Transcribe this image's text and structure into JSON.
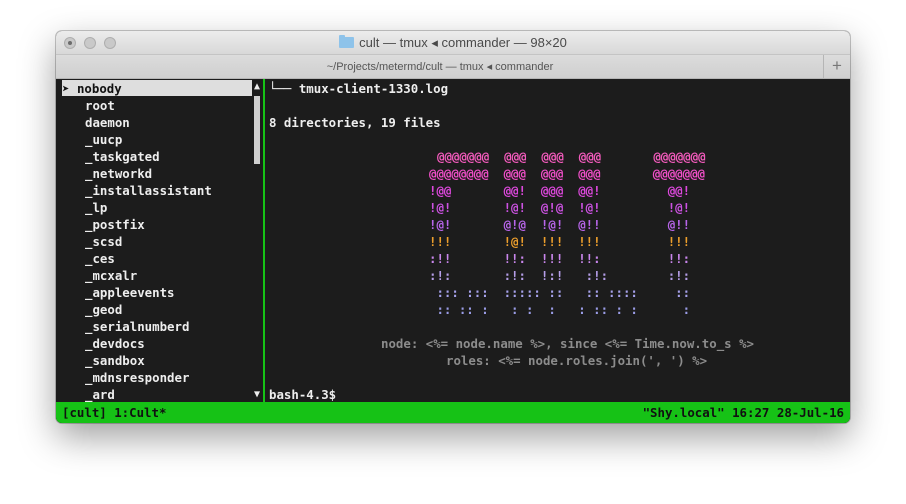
{
  "window": {
    "title": "cult — tmux ◂ commander — 98×20",
    "tab_title": "~/Projects/metermd/cult — tmux ◂ commander",
    "new_tab_label": "+"
  },
  "left_pane": {
    "selected_marker": "➤",
    "users": [
      "nobody",
      "root",
      "daemon",
      "_uucp",
      "_taskgated",
      "_networkd",
      "_installassistant",
      "_lp",
      "_postfix",
      "_scsd",
      "_ces",
      "_mcxalr",
      "_appleevents",
      "_geod",
      "_serialnumberd",
      "_devdocs",
      "_sandbox",
      "_mdnsresponder",
      "_ard"
    ],
    "scroll_up": "▲",
    "scroll_down": "▼"
  },
  "right_pane": {
    "tree_line": "└── tmux-client-1330.log",
    "summary": "8 directories, 19 files",
    "ascii_art": [
      "@@@@@@@  @@@  @@@  @@@       @@@@@@@",
      "@@@@@@@@  @@@  @@@  @@@       @@@@@@@",
      "!@@       @@!  @@@  @@!         @@!",
      "!@!       !@!  @!@  !@!         !@!",
      "!@!       @!@  !@!  @!!         @!!",
      "!!!       !@!  !!!  !!!         !!!",
      ":!!       !!:  !!!  !!:         !!:",
      ":!:       :!:  !:!   :!:        :!:",
      " ::: :::  ::::: ::   :: ::::     ::",
      " :: :: :   : :  :   : :: : :      :"
    ],
    "info_line1": "node: <%= node.name %>, since <%= Time.now.to_s %>",
    "info_line2": "roles: <%= node.roles.join(', ') %>",
    "prompt": "bash-4.3$"
  },
  "status_bar": {
    "left": "[cult] 1:Cult*",
    "right": "\"Shy.local\" 16:27 28-Jul-16"
  },
  "colors": {
    "terminal_bg": "#1c1c1c",
    "status_green": "#16c216",
    "art_pink": "#f45bbd",
    "art_magenta": "#dd48dd",
    "art_orange": "#ec9e2c",
    "art_lavender": "#a7a2ec",
    "info_gray": "#8c8c8c"
  }
}
